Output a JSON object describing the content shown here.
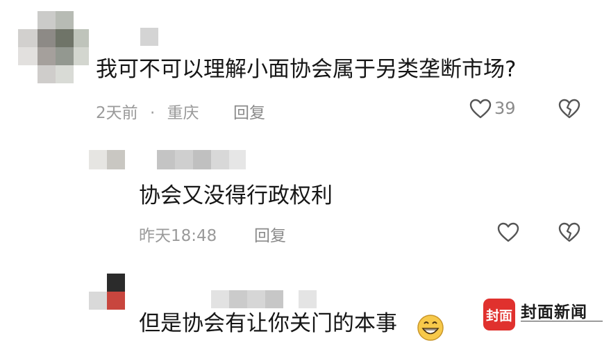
{
  "comments": [
    {
      "text": "我可不可以理解小面协会属于另类垄断市场?",
      "time": "2天前",
      "location": "重庆",
      "reply_label": "回复",
      "likes": "39"
    },
    {
      "text": "协会又没得行政权利",
      "time": "昨天18:48",
      "reply_label": "回复"
    },
    {
      "text": "但是协会有让你关门的本事"
    }
  ],
  "meta_separator": "·",
  "watermark": {
    "badge": "封面",
    "title": "封面新闻"
  },
  "icons": {
    "like": "heart-outline-icon",
    "dislike": "broken-heart-icon",
    "emoji": "grinning-emoji-icon"
  },
  "colors": {
    "text": "#161616",
    "meta": "#9a9a9a",
    "brand_red": "#e0312e"
  }
}
